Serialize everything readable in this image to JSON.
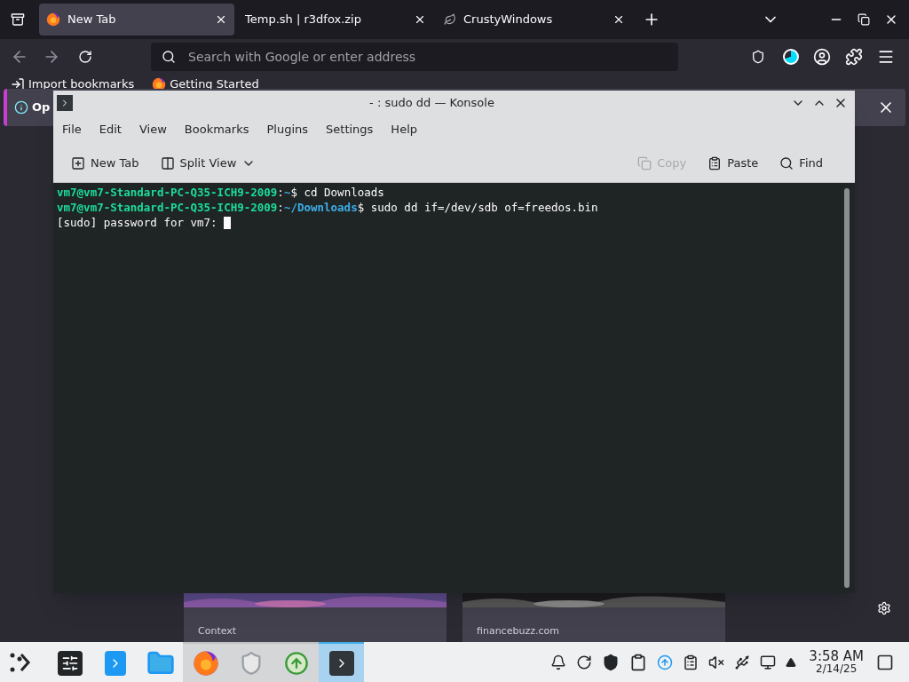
{
  "browser": {
    "tabs": [
      {
        "label": "New Tab",
        "selected": true,
        "kind": "firefox"
      },
      {
        "label": "Temp.sh | r3dfox.zip",
        "selected": false,
        "kind": "plain"
      },
      {
        "label": "CrustyWindows",
        "selected": false,
        "kind": "leaf"
      }
    ],
    "address": {
      "placeholder": "Search with Google or enter address"
    },
    "bookmarks": [
      {
        "label": "Import bookmarks",
        "kind": "import"
      },
      {
        "label": "Getting Started",
        "kind": "firefox"
      }
    ],
    "notice": {
      "text": "Op"
    },
    "cards": [
      {
        "label": "Context"
      },
      {
        "label": "financebuzz.com"
      }
    ]
  },
  "konsole": {
    "title": "- : sudo dd — Konsole",
    "menu": [
      "File",
      "Edit",
      "View",
      "Bookmarks",
      "Plugins",
      "Settings",
      "Help"
    ],
    "toolbar": [
      {
        "label": "New Tab",
        "kind": "newtab",
        "disabled": false
      },
      {
        "label": "Split View",
        "kind": "split",
        "disabled": false
      },
      {
        "label": "Copy",
        "kind": "copy",
        "disabled": true
      },
      {
        "label": "Paste",
        "kind": "paste",
        "disabled": false
      },
      {
        "label": "Find",
        "kind": "find",
        "disabled": false
      }
    ],
    "lines": [
      {
        "segments": [
          {
            "text": "vm7@vm7-Standard-PC-Q35-ICH9-2009",
            "kind": "user"
          },
          {
            "text": ":",
            "kind": "plain"
          },
          {
            "text": "~",
            "kind": "path"
          },
          {
            "text": "$ cd Downloads",
            "kind": "plain"
          }
        ],
        "cursor": false
      },
      {
        "segments": [
          {
            "text": "vm7@vm7-Standard-PC-Q35-ICH9-2009",
            "kind": "user"
          },
          {
            "text": ":",
            "kind": "plain"
          },
          {
            "text": "~/Downloads",
            "kind": "path"
          },
          {
            "text": "$ sudo dd if=/dev/sdb of=freedos.bin",
            "kind": "plain"
          }
        ],
        "cursor": false
      },
      {
        "segments": [
          {
            "text": "[sudo] password for vm7: ",
            "kind": "plain"
          }
        ],
        "cursor": true
      }
    ]
  },
  "taskbar": {
    "apps": [
      {
        "kind": "settings",
        "running": false,
        "selected": false
      },
      {
        "kind": "store",
        "running": false,
        "selected": false
      },
      {
        "kind": "folder",
        "running": false,
        "selected": false
      },
      {
        "kind": "firefox",
        "running": true,
        "selected": false
      },
      {
        "kind": "shield",
        "running": true,
        "selected": false
      },
      {
        "kind": "update",
        "running": true,
        "selected": false
      },
      {
        "kind": "terminal",
        "running": true,
        "selected": true
      }
    ],
    "time": "3:58 AM",
    "date": "2/14/25"
  }
}
